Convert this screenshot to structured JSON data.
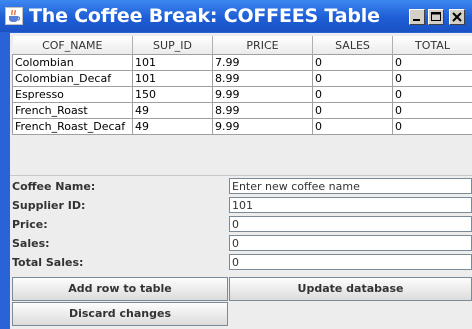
{
  "window": {
    "title": "The Coffee Break: COFFEES Table"
  },
  "table": {
    "columns": [
      "COF_NAME",
      "SUP_ID",
      "PRICE",
      "SALES",
      "TOTAL"
    ],
    "rows": [
      [
        "Colombian",
        "101",
        "7.99",
        "0",
        "0"
      ],
      [
        "Colombian_Decaf",
        "101",
        "8.99",
        "0",
        "0"
      ],
      [
        "Espresso",
        "150",
        "9.99",
        "0",
        "0"
      ],
      [
        "French_Roast",
        "49",
        "8.99",
        "0",
        "0"
      ],
      [
        "French_Roast_Decaf",
        "49",
        "9.99",
        "0",
        "0"
      ]
    ]
  },
  "form": {
    "coffee_name": {
      "label": "Coffee Name:",
      "value": "Enter new coffee name"
    },
    "supplier_id": {
      "label": "Supplier ID:",
      "value": "101"
    },
    "price": {
      "label": "Price:",
      "value": "0"
    },
    "sales": {
      "label": "Sales:",
      "value": "0"
    },
    "total_sales": {
      "label": "Total Sales:",
      "value": "0"
    }
  },
  "buttons": {
    "add_row": "Add row to table",
    "update_database": "Update database",
    "discard_changes": "Discard changes"
  },
  "icons": {
    "app": "java-coffee-cup-icon",
    "minimize": "minimize-icon",
    "maximize": "maximize-icon",
    "close": "close-icon"
  },
  "colors": {
    "titlebar": "#2a62d8",
    "panel": "#ededed"
  }
}
